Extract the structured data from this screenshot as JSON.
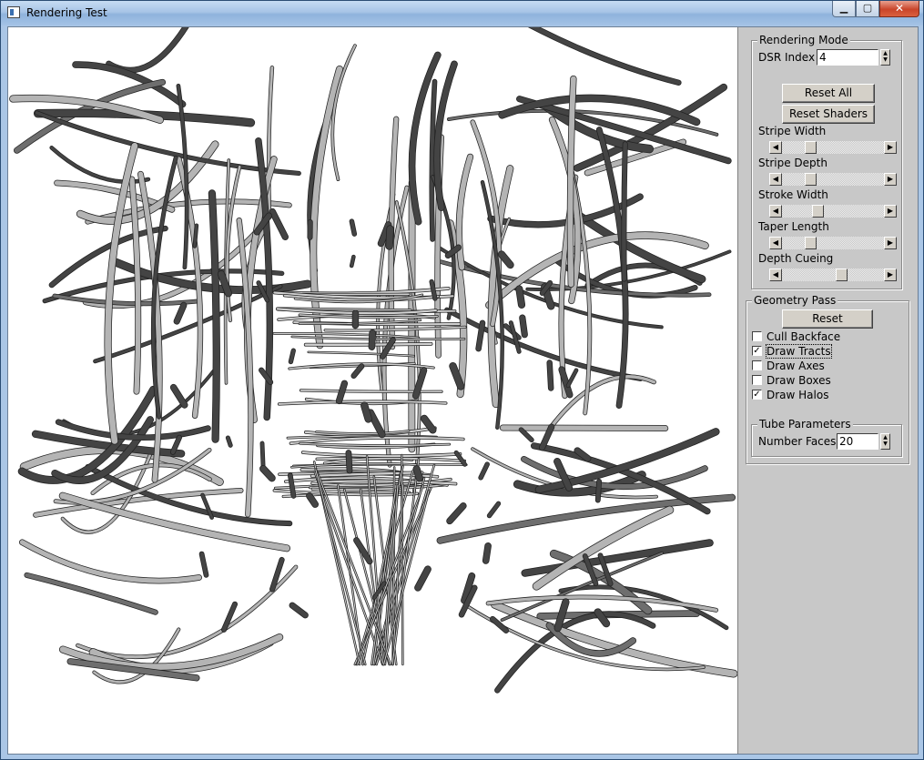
{
  "window": {
    "title": "Rendering Test",
    "minimize_glyph": "▁",
    "maximize_glyph": "▢",
    "close_glyph": "✕"
  },
  "rendering_mode": {
    "group_label": "Rendering Mode",
    "dsr_index_label": "DSR Index",
    "dsr_index_value": "4",
    "reset_all_label": "Reset All",
    "reset_shaders_label": "Reset Shaders",
    "sliders": [
      {
        "label": "Stripe Width",
        "level": 0.25
      },
      {
        "label": "Stripe Depth",
        "level": 0.25
      },
      {
        "label": "Stroke Width",
        "level": 0.33
      },
      {
        "label": "Taper Length",
        "level": 0.25
      },
      {
        "label": "Depth Cueing",
        "level": 0.6
      }
    ]
  },
  "geometry_pass": {
    "group_label": "Geometry Pass",
    "reset_label": "Reset",
    "checkboxes": [
      {
        "label": "Cull Backface",
        "checked": false
      },
      {
        "label": "Draw Tracts",
        "checked": true
      },
      {
        "label": "Draw Axes",
        "checked": false
      },
      {
        "label": "Draw Boxes",
        "checked": false
      },
      {
        "label": "Draw Halos",
        "checked": true
      }
    ]
  },
  "tube_parameters": {
    "group_label": "Tube Parameters",
    "number_faces_label": "Number Faces",
    "number_faces_value": "20"
  },
  "colors": {
    "panel_bg": "#c8c8c8",
    "titlebar": "#a7c4e6",
    "tract_dark": "#444444",
    "tract_light": "#b4b4b4"
  },
  "icons": [
    "app-icon",
    "minimize-icon",
    "maximize-icon",
    "close-icon",
    "spin-up-down-icon",
    "arrow-left-icon",
    "arrow-right-icon",
    "checkmark-icon"
  ]
}
